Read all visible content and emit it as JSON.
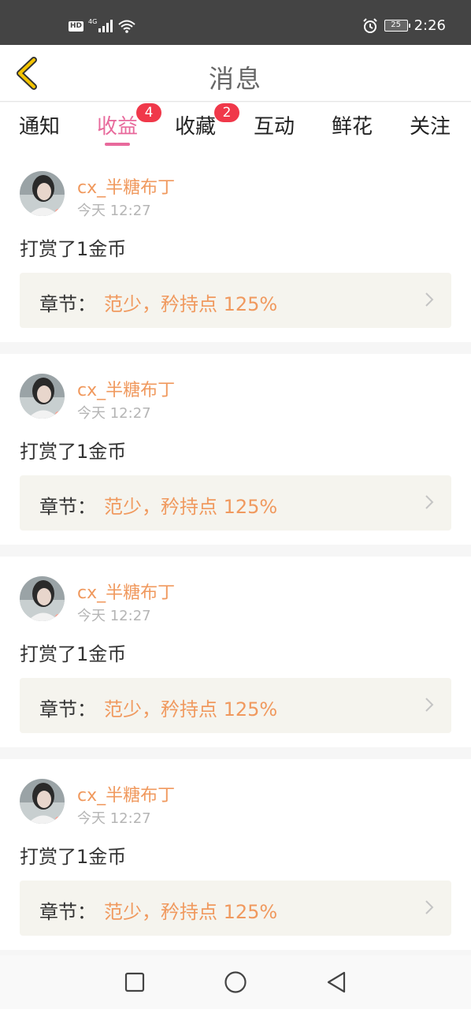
{
  "status_bar": {
    "hd": "HD",
    "network": "4G",
    "battery": "25",
    "time": "2:26",
    "icons": [
      "signal-icon",
      "wifi-icon",
      "alarm-icon",
      "battery-icon"
    ]
  },
  "header": {
    "title": "消息",
    "back_icon": "chevron-left-icon",
    "back_color": "#f4c400"
  },
  "tabs": [
    {
      "label": "通知",
      "badge": ""
    },
    {
      "label": "收益",
      "badge": "4",
      "active": true
    },
    {
      "label": "收藏",
      "badge": "2"
    },
    {
      "label": "互动",
      "badge": ""
    },
    {
      "label": "鲜花",
      "badge": ""
    },
    {
      "label": "关注",
      "badge": ""
    }
  ],
  "notifications": [
    {
      "user": "cx_半糖布丁",
      "time": "今天 12:27",
      "message": "打赏了1金币",
      "chapter_label": "章节：",
      "chapter_title": "范少，矜持点 125%"
    },
    {
      "user": "cx_半糖布丁",
      "time": "今天 12:27",
      "message": "打赏了1金币",
      "chapter_label": "章节：",
      "chapter_title": "范少，矜持点 125%"
    },
    {
      "user": "cx_半糖布丁",
      "time": "今天 12:27",
      "message": "打赏了1金币",
      "chapter_label": "章节：",
      "chapter_title": "范少，矜持点 125%"
    },
    {
      "user": "cx_半糖布丁",
      "time": "今天 12:27",
      "message": "打赏了1金币",
      "chapter_label": "章节：",
      "chapter_title": "范少，矜持点 125%"
    }
  ],
  "colors": {
    "accent": "#e86a9c",
    "username": "#f0995e",
    "badge": "#f0384a",
    "chapter_bg": "#f5f4ee"
  },
  "nav_bar": {
    "icons": [
      "recents-square-icon",
      "home-circle-icon",
      "back-triangle-icon"
    ]
  }
}
